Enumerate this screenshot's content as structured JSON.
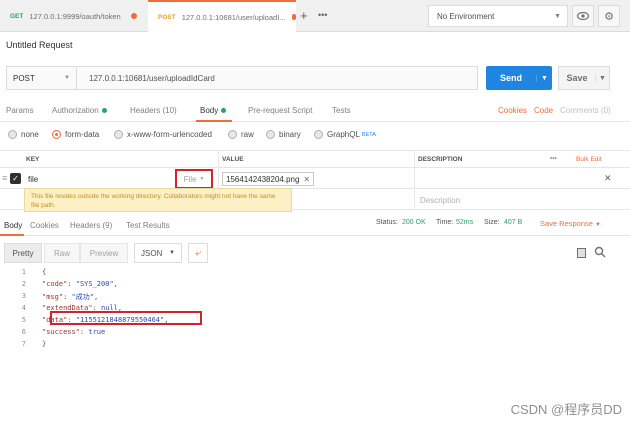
{
  "tabs": [
    {
      "method": "GET",
      "url": "127.0.0.1:9999/oauth/token"
    },
    {
      "method": "POST",
      "url": "127.0.0.1:10681/user/uploadI..."
    }
  ],
  "environment": {
    "selected": "No Environment"
  },
  "request": {
    "title": "Untitled Request",
    "method": "POST",
    "url": "127.0.0.1:10681/user/uploadIdCard",
    "send_label": "Send",
    "save_label": "Save"
  },
  "request_tabs": {
    "params": "Params",
    "authorization": "Authorization",
    "headers": "Headers (10)",
    "body": "Body",
    "prerequest": "Pre-request Script",
    "tests": "Tests",
    "cookies": "Cookies",
    "code": "Code",
    "comments": "Comments (0)"
  },
  "body_types": {
    "none": "none",
    "form_data": "form-data",
    "urlencoded": "x-www-form-urlencoded",
    "raw": "raw",
    "binary": "binary",
    "graphql": "GraphQL",
    "beta": "BETA"
  },
  "kv": {
    "key_header": "KEY",
    "value_header": "VALUE",
    "desc_header": "DESCRIPTION",
    "more": "•••",
    "bulk_edit": "Bulk Edit",
    "row_key": "file",
    "row_type": "File",
    "row_value": "1564142438204.png",
    "desc_placeholder": "Description",
    "warning": "This file resides outside the working directory. Collaborators might not have the same file path."
  },
  "response": {
    "tabs": {
      "body": "Body",
      "cookies": "Cookies",
      "headers": "Headers (9)",
      "test_results": "Test Results"
    },
    "status_label": "Status:",
    "status_value": "200 OK",
    "time_label": "Time:",
    "time_value": "52ms",
    "size_label": "Size:",
    "size_value": "407 B",
    "save_response": "Save Response",
    "view": {
      "pretty": "Pretty",
      "raw": "Raw",
      "preview": "Preview",
      "format": "JSON"
    },
    "lines": [
      {
        "n": "1",
        "text": "{"
      },
      {
        "n": "2",
        "key": "\"code\"",
        "val": "\"SYS_200\","
      },
      {
        "n": "3",
        "key": "\"msg\"",
        "val": "\"成功\","
      },
      {
        "n": "4",
        "key": "\"extendData\"",
        "val": "null,"
      },
      {
        "n": "5",
        "key": "\"data\"",
        "val": "\"1155121848879550464\","
      },
      {
        "n": "6",
        "key": "\"success\"",
        "val": "true"
      },
      {
        "n": "7",
        "text": "}"
      }
    ]
  },
  "watermark": "CSDN @程序员DD"
}
